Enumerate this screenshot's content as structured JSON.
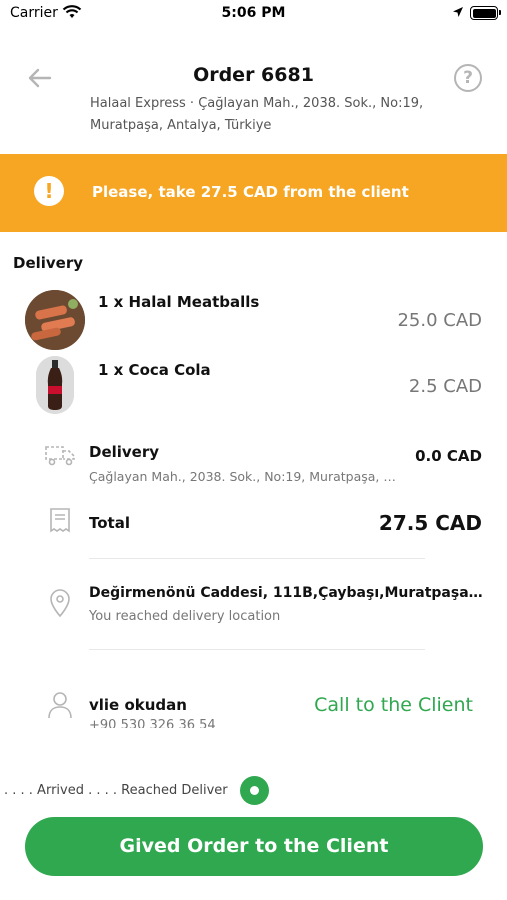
{
  "status_bar": {
    "carrier": "Carrier",
    "time": "5:06 PM"
  },
  "header": {
    "title": "Order 6681",
    "restaurant_line1": "Halaal Express · Çağlayan Mah., 2038. Sok., No:19,",
    "restaurant_line2": "Muratpaşa, Antalya, Türkiye",
    "help_label": "?"
  },
  "alert": {
    "text": "Please, take 27.5 CAD from the client",
    "icon_label": "!",
    "color": "#f6a623"
  },
  "order": {
    "section_label": "Delivery",
    "items": [
      {
        "name": "1 x Halal Meatballs",
        "price": "25.0 CAD",
        "image": "meatballs-photo"
      },
      {
        "name": "1 x Coca Cola",
        "price": "2.5 CAD",
        "image": "coca-cola-bottle-photo"
      }
    ],
    "delivery": {
      "label": "Delivery",
      "address": "Çağlayan Mah., 2038. Sok., No:19, Muratpaşa, Antalya, Türkiye",
      "price": "0.0 CAD"
    },
    "total": {
      "label": "Total",
      "price": "27.5 CAD"
    }
  },
  "destination": {
    "address": "Değirmenönü Caddesi, 111B,Çaybaşı,Muratpaşa,0...",
    "status": "You reached delivery location"
  },
  "client": {
    "name": "vlie okudan",
    "phone": "+90 530 326 36 54",
    "call_label": "Call to the Client"
  },
  "progress": {
    "text": ". . . . Arrived . . . . Reached Deliver"
  },
  "action": {
    "label": "Gived Order to the Client"
  },
  "colors": {
    "accent_green": "#2fa84f",
    "alert_orange": "#f6a623"
  }
}
